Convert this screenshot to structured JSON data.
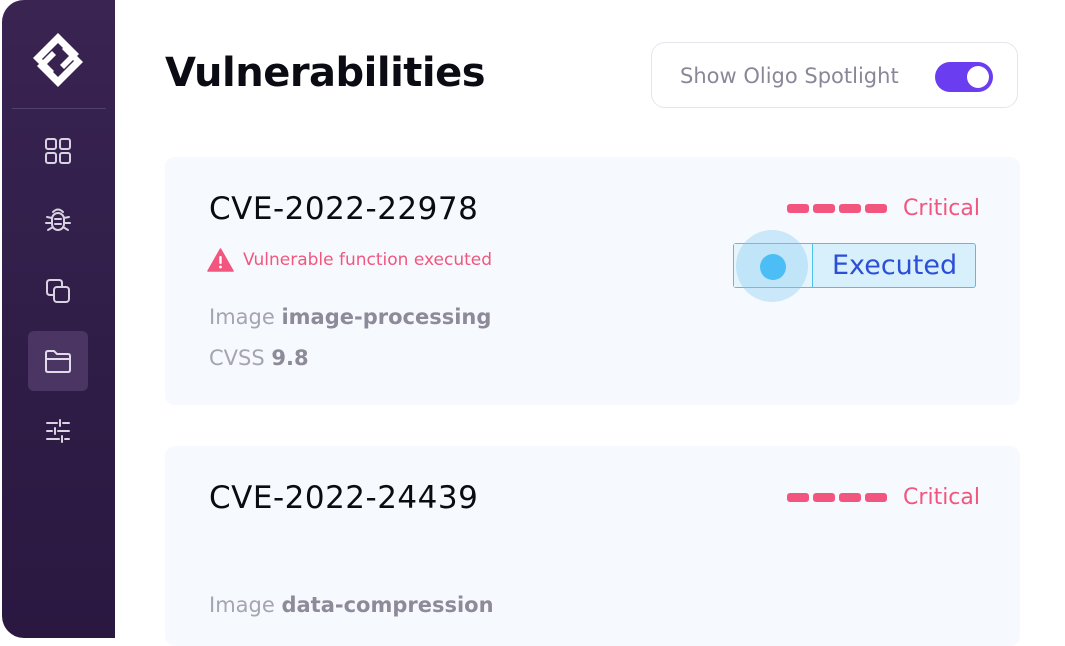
{
  "sidebar": {
    "logo": "oligo-logo",
    "items": [
      {
        "icon": "grid-icon",
        "active": false
      },
      {
        "icon": "bug-icon",
        "active": false
      },
      {
        "icon": "copy-icon",
        "active": false
      },
      {
        "icon": "folder-icon",
        "active": true
      },
      {
        "icon": "sliders-icon",
        "active": false
      }
    ]
  },
  "header": {
    "title": "Vulnerabilities",
    "spotlight_label": "Show Oligo Spotlight",
    "spotlight_on": true
  },
  "vulnerabilities": [
    {
      "id": "CVE-2022-22978",
      "severity": "Critical",
      "severity_level": 4,
      "warning": "Vulnerable function executed",
      "status_label": "Executed",
      "image_label": "Image",
      "image": "image-processing",
      "cvss_label": "CVSS",
      "cvss": "9.8"
    },
    {
      "id": "CVE-2022-24439",
      "severity": "Critical",
      "severity_level": 4,
      "image_label": "Image",
      "image": "data-compression"
    }
  ],
  "colors": {
    "sidebar_bg": "#2f1d47",
    "accent": "#6b3df0",
    "critical": "#f2567e",
    "executed_border": "#4fc0ee",
    "executed_text": "#2d4fd8"
  }
}
